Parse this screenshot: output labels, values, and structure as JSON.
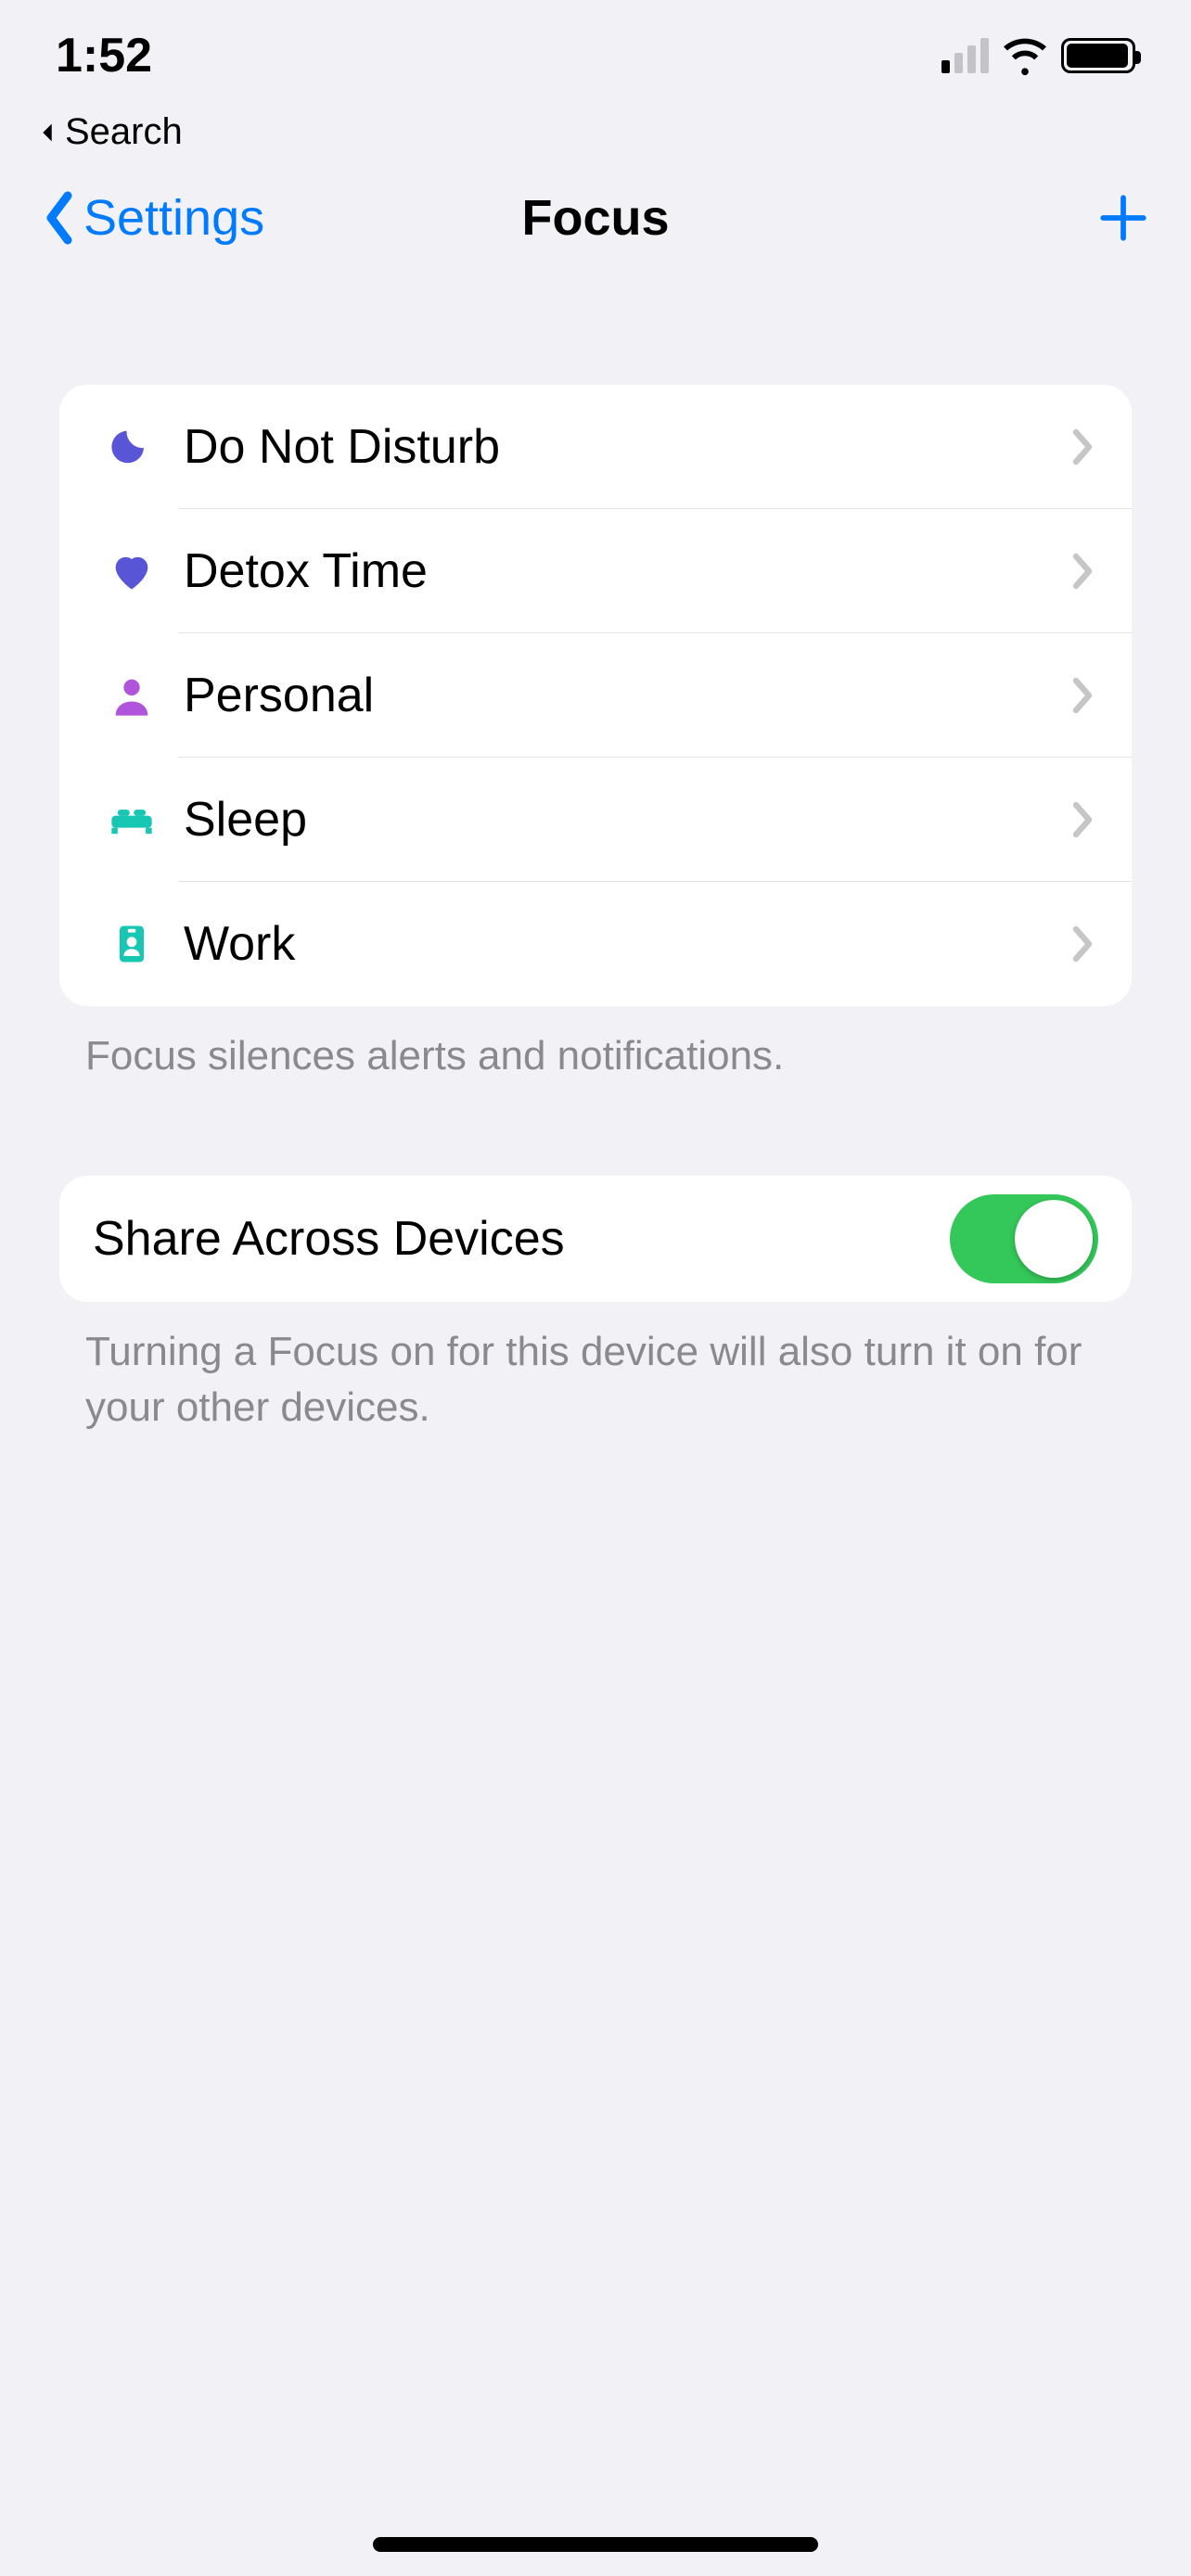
{
  "status": {
    "time": "1:52",
    "breadcrumb_label": "Search"
  },
  "nav": {
    "back_label": "Settings",
    "title": "Focus"
  },
  "focus_list": [
    {
      "icon": "moon",
      "icon_color": "#5856d6",
      "label": "Do Not Disturb"
    },
    {
      "icon": "heart",
      "icon_color": "#5856d6",
      "label": "Detox Time"
    },
    {
      "icon": "person",
      "icon_color": "#b054db",
      "label": "Personal"
    },
    {
      "icon": "bed",
      "icon_color": "#17c7b3",
      "label": "Sleep"
    },
    {
      "icon": "badge",
      "icon_color": "#17c7b3",
      "label": "Work"
    }
  ],
  "focus_footer": "Focus silences alerts and notifications.",
  "share": {
    "label": "Share Across Devices",
    "on": true,
    "footer": "Turning a Focus on for this device will also turn it on for your other devices."
  }
}
